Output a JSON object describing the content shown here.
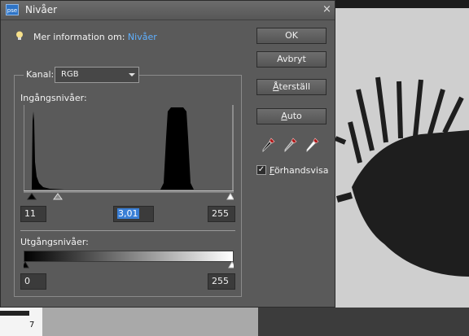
{
  "window": {
    "app_badge": "pse",
    "title": "Nivåer",
    "close": "×"
  },
  "info": {
    "label": "Mer information om:",
    "link": "Nivåer"
  },
  "channel": {
    "label": "Kanal:",
    "value": "RGB"
  },
  "input_levels": {
    "label": "Ingångsnivåer:",
    "black": "11",
    "gamma": "3,01",
    "white": "255",
    "black_value": 11,
    "gamma_value": 3.01,
    "white_value": 255
  },
  "output_levels": {
    "label": "Utgångsnivåer:",
    "black": "0",
    "white": "255",
    "black_value": 0,
    "white_value": 255
  },
  "buttons": {
    "ok": "OK",
    "cancel": "Avbryt",
    "reset": {
      "mnemonic": "Å",
      "rest": "terställ"
    },
    "auto": {
      "mnemonic": "A",
      "rest": "uto"
    }
  },
  "eyedroppers": [
    "black-point-eyedropper-icon",
    "gray-point-eyedropper-icon",
    "white-point-eyedropper-icon"
  ],
  "preview": {
    "checked": true,
    "check_glyph": "✓",
    "mnemonic": "F",
    "rest": "örhandsvisa"
  },
  "ruler_digit": "7",
  "colors": {
    "dialog_bg": "#5a5a5a",
    "link": "#5fb0ff",
    "selection": "#3a7fd6",
    "app_icon": "#2d74c7"
  }
}
